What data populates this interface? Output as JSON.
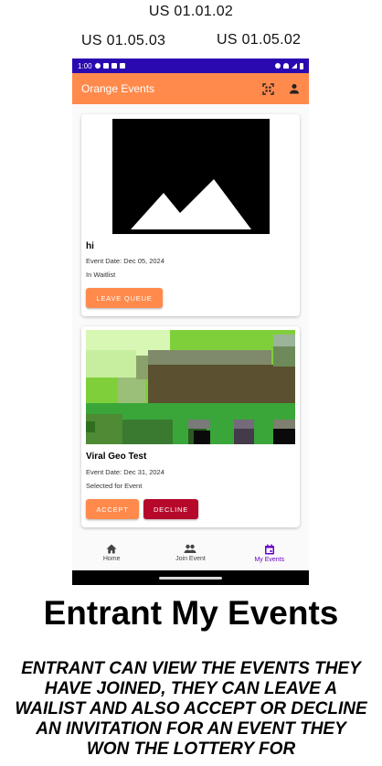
{
  "stories": {
    "top": "US 01.01.02",
    "left": "US 01.05.03",
    "right": "US 01.05.02"
  },
  "statusbar": {
    "time": "1:00"
  },
  "appbar": {
    "title": "Orange Events",
    "icons": [
      "qr-scan-icon",
      "account-icon"
    ]
  },
  "events": [
    {
      "name": "hi",
      "date": "Event Date: Dec 05, 2024",
      "status": "In Waitlist",
      "image": "placeholder-image-icon",
      "actions": [
        "LEAVE QUEUE"
      ]
    },
    {
      "name": "Viral Geo Test",
      "date": "Event Date: Dec 31, 2024",
      "status": "Selected for Event",
      "image": "pixelated-map-image",
      "actions": [
        "ACCEPT",
        "DECLINE"
      ]
    }
  ],
  "nav": {
    "items": [
      {
        "label": "Home",
        "icon": "home-icon"
      },
      {
        "label": "Join Event",
        "icon": "people-icon"
      },
      {
        "label": "My Events",
        "icon": "calendar-icon"
      }
    ],
    "active": "My Events"
  },
  "colors": {
    "status_bar": "#2a0ab0",
    "app_bar": "#ff8a4c",
    "decline": "#b5082a",
    "active_nav": "#6a00c8"
  },
  "caption": {
    "title": "Entrant My Events",
    "description": "ENTRANT CAN VIEW THE EVENTS THEY HAVE JOINED, THEY CAN LEAVE A WAILIST AND ALSO ACCEPT OR DECLINE AN INVITATION FOR AN EVENT THEY WON THE LOTTERY FOR"
  }
}
